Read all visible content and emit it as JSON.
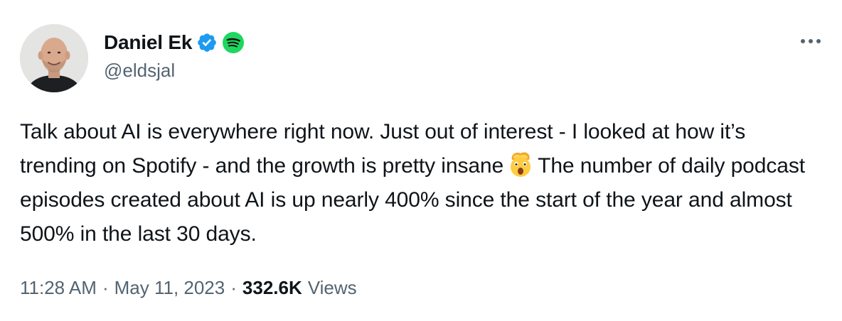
{
  "author": {
    "display_name": "Daniel Ek",
    "handle": "@eldsjal",
    "verified": true,
    "affiliate": "spotify-icon",
    "verified_color": "#1d9bf0",
    "affiliate_color": "#1ed760"
  },
  "tweet": {
    "text_before_emoji": "Talk about AI is everywhere right now. Just out of interest - I looked at how it’s trending on Spotify - and the growth is pretty insane",
    "emoji": "exploding-head-emoji",
    "text_after_emoji": "The number of daily podcast episodes created about AI is up nearly 400% since the start of the year and almost 500% in the last 30 days."
  },
  "meta": {
    "time": "11:28 AM",
    "separator": "·",
    "date": "May 11, 2023",
    "views_count": "332.6K",
    "views_label": "Views"
  },
  "icons": {
    "more": "more-horizontal-icon",
    "verified": "verified-badge-icon"
  },
  "colors": {
    "text_primary": "#0f1419",
    "text_secondary": "#536471"
  }
}
